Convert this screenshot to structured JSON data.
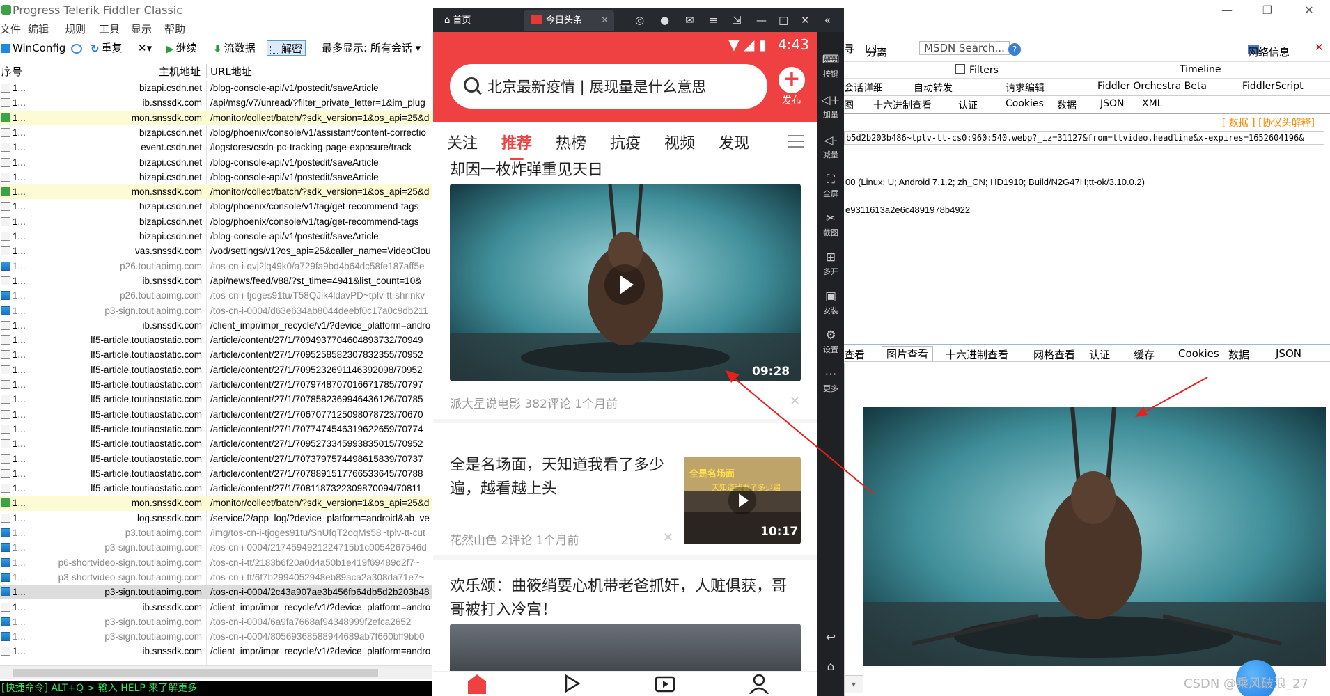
{
  "fiddler": {
    "title": "Progress Telerik Fiddler Classic",
    "window_controls": [
      "—",
      "❐",
      "✕"
    ],
    "menu": [
      "文件",
      "编辑",
      "规则",
      "工具",
      "显示",
      "帮助"
    ],
    "toolbar": {
      "winconfig": "WinConfig",
      "replay": "重复",
      "remove": "✕▾",
      "resume": "继续",
      "stream": "流数据",
      "decode": "解密",
      "keep": "最多显示: 所有会话 ▾"
    },
    "columns": {
      "num": "序号",
      "host": "主机地址",
      "url": "URL地址"
    },
    "sessions": [
      {
        "icon": "js",
        "num": "1...",
        "host": "bizapi.csdn.net",
        "url": "/blog-console-api/v1/postedit/saveArticle",
        "style": ""
      },
      {
        "icon": "js",
        "num": "1...",
        "host": "ib.snssdk.com",
        "url": "/api/msg/v7/unread/?filter_private_letter=1&im_plug",
        "style": ""
      },
      {
        "icon": "upd",
        "num": "1...",
        "host": "mon.snssdk.com",
        "url": "/monitor/collect/batch/?sdk_version=1&os_api=25&d",
        "style": "hl"
      },
      {
        "icon": "js",
        "num": "1...",
        "host": "bizapi.csdn.net",
        "url": "/blog/phoenix/console/v1/assistant/content-correctio",
        "style": ""
      },
      {
        "icon": "js",
        "num": "1...",
        "host": "event.csdn.net",
        "url": "/logstores/csdn-pc-tracking-page-exposure/track",
        "style": ""
      },
      {
        "icon": "js",
        "num": "1...",
        "host": "bizapi.csdn.net",
        "url": "/blog-console-api/v1/postedit/saveArticle",
        "style": ""
      },
      {
        "icon": "js",
        "num": "1...",
        "host": "bizapi.csdn.net",
        "url": "/blog-console-api/v1/postedit/saveArticle",
        "style": ""
      },
      {
        "icon": "upd",
        "num": "1...",
        "host": "mon.snssdk.com",
        "url": "/monitor/collect/batch/?sdk_version=1&os_api=25&d",
        "style": "hl"
      },
      {
        "icon": "js",
        "num": "1...",
        "host": "bizapi.csdn.net",
        "url": "/blog/phoenix/console/v1/tag/get-recommend-tags",
        "style": ""
      },
      {
        "icon": "js",
        "num": "1...",
        "host": "bizapi.csdn.net",
        "url": "/blog/phoenix/console/v1/tag/get-recommend-tags",
        "style": ""
      },
      {
        "icon": "js",
        "num": "1...",
        "host": "bizapi.csdn.net",
        "url": "/blog-console-api/v1/postedit/saveArticle",
        "style": ""
      },
      {
        "icon": "js",
        "num": "1...",
        "host": "vas.snssdk.com",
        "url": "/vod/settings/v1?os_api=25&caller_name=VideoClou",
        "style": ""
      },
      {
        "icon": "img",
        "num": "1...",
        "host": "p26.toutiaoimg.com",
        "url": "/tos-cn-i-qvj2lq49k0/a729fa9bd4b64dc58fe187aff5e",
        "style": "gray"
      },
      {
        "icon": "js",
        "num": "1...",
        "host": "ib.snssdk.com",
        "url": "/api/news/feed/v88/?st_time=4941&list_count=10&",
        "style": ""
      },
      {
        "icon": "img",
        "num": "1...",
        "host": "p26.toutiaoimg.com",
        "url": "/tos-cn-i-tjoges91tu/T58QJlk4ldavPD~tplv-tt-shrinkv",
        "style": "gray"
      },
      {
        "icon": "img",
        "num": "1...",
        "host": "p3-sign.toutiaoimg.com",
        "url": "/tos-cn-i-0004/d63e634ab8044deebf0c17a0c9db211",
        "style": "gray"
      },
      {
        "icon": "js",
        "num": "1...",
        "host": "ib.snssdk.com",
        "url": "/client_impr/impr_recycle/v1/?device_platform=andro",
        "style": ""
      },
      {
        "icon": "js",
        "num": "1...",
        "host": "lf5-article.toutiaostatic.com",
        "url": "/article/content/27/1/7094937704604893732/70949",
        "style": ""
      },
      {
        "icon": "js",
        "num": "1...",
        "host": "lf5-article.toutiaostatic.com",
        "url": "/article/content/27/1/7095258582307832355/70952",
        "style": ""
      },
      {
        "icon": "js",
        "num": "1...",
        "host": "lf5-article.toutiaostatic.com",
        "url": "/article/content/27/1/7095232691146392098/70952",
        "style": ""
      },
      {
        "icon": "js",
        "num": "1...",
        "host": "lf5-article.toutiaostatic.com",
        "url": "/article/content/27/1/7079748707016671785/70797",
        "style": ""
      },
      {
        "icon": "js",
        "num": "1...",
        "host": "lf5-article.toutiaostatic.com",
        "url": "/article/content/27/1/7078582369946436126/70785",
        "style": ""
      },
      {
        "icon": "js",
        "num": "1...",
        "host": "lf5-article.toutiaostatic.com",
        "url": "/article/content/27/1/7067077125098078723/70670",
        "style": ""
      },
      {
        "icon": "js",
        "num": "1...",
        "host": "lf5-article.toutiaostatic.com",
        "url": "/article/content/27/1/7077474546319622659/70774",
        "style": ""
      },
      {
        "icon": "js",
        "num": "1...",
        "host": "lf5-article.toutiaostatic.com",
        "url": "/article/content/27/1/7095273345993835015/70952",
        "style": ""
      },
      {
        "icon": "js",
        "num": "1...",
        "host": "lf5-article.toutiaostatic.com",
        "url": "/article/content/27/1/7073797574498615839/70737",
        "style": ""
      },
      {
        "icon": "js",
        "num": "1...",
        "host": "lf5-article.toutiaostatic.com",
        "url": "/article/content/27/1/7078891517766533645/70788",
        "style": ""
      },
      {
        "icon": "js",
        "num": "1...",
        "host": "lf5-article.toutiaostatic.com",
        "url": "/article/content/27/1/7081187322309870094/70811",
        "style": ""
      },
      {
        "icon": "upd",
        "num": "1...",
        "host": "mon.snssdk.com",
        "url": "/monitor/collect/batch/?sdk_version=1&os_api=25&d",
        "style": "hl"
      },
      {
        "icon": "js",
        "num": "1...",
        "host": "log.snssdk.com",
        "url": "/service/2/app_log/?device_platform=android&ab_ve",
        "style": ""
      },
      {
        "icon": "img",
        "num": "1...",
        "host": "p3.toutiaoimg.com",
        "url": "/img/tos-cn-i-tjoges91tu/SnUfqT2oqMs58~tplv-tt-cut",
        "style": "gray"
      },
      {
        "icon": "img",
        "num": "1...",
        "host": "p3-sign.toutiaoimg.com",
        "url": "/tos-cn-i-0004/2174594921224715b1c0054267546d",
        "style": "gray"
      },
      {
        "icon": "img",
        "num": "1...",
        "host": "p6-shortvideo-sign.toutiaoimg.com",
        "url": "/tos-cn-i-tt/2183b6f20a0d4a50b1e419f69489d2f7~",
        "style": "gray"
      },
      {
        "icon": "img",
        "num": "1...",
        "host": "p3-shortvideo-sign.toutiaoimg.com",
        "url": "/tos-cn-i-tt/6f7b2994052948eb89aca2a308da71e7~",
        "style": "gray"
      },
      {
        "icon": "img",
        "num": "1...",
        "host": "p3-sign.toutiaoimg.com",
        "url": "/tos-cn-i-0004/2c43a907ae3b456fb64db5d2b203b48",
        "style": "sel"
      },
      {
        "icon": "js",
        "num": "1...",
        "host": "ib.snssdk.com",
        "url": "/client_impr/impr_recycle/v1/?device_platform=andro",
        "style": ""
      },
      {
        "icon": "img",
        "num": "1...",
        "host": "p3-sign.toutiaoimg.com",
        "url": "/tos-cn-i-0004/6a9fa7668af94348999f2efca2652",
        "style": "gray"
      },
      {
        "icon": "img",
        "num": "1...",
        "host": "p3-sign.toutiaoimg.com",
        "url": "/tos-cn-i-0004/80569368588944689ab7f660bff9bb0",
        "style": "gray"
      },
      {
        "icon": "js",
        "num": "1...",
        "host": "ib.snssdk.com",
        "url": "/client_impr/impr_recycle/v1/?device_platform=andro",
        "style": ""
      }
    ],
    "quickexec": "[快捷命令] ALT+Q > 输入 HELP 来了解更多",
    "right_toolbar": {
      "a": "寻",
      "split": "分离",
      "msdn": "MSDN Search...",
      "help": "?",
      "netinfo": "网络信息",
      "close": "✕"
    },
    "right_tabs_row1": {
      "filters": "Filters",
      "timeline": "Timeline"
    },
    "right_tabs_row2": [
      "会话详细",
      "自动转发",
      "请求编辑",
      "Fiddler Orchestra Beta",
      "FiddlerScript"
    ],
    "right_tabs_row3": [
      "图",
      "十六进制查看",
      "认证",
      "Cookies",
      "数据",
      "JSON",
      "XML"
    ],
    "proto_bar": "[ 数据 ] [协议头解释]",
    "request_line": "b5d2b203b486~tplv-tt-cs0:960:540.webp?_iz=31127&from=ttvideo.headlinе&x-expires=1652604196&",
    "request_ua": "00 (Linux; U; Android 7.1.2; zh_CN; HD1910; Build/N2G47H;tt-ok/3.10.0.2)",
    "request_hash": "e9311613a2e6c4891978b4922",
    "response_tabs": [
      "查看",
      "图片查看",
      "十六进制查看",
      "网格查看",
      "认证",
      "缓存",
      "Cookies",
      "数据",
      "JSON"
    ],
    "watermark": "CSDN @乘风破浪_27"
  },
  "emulator": {
    "tab_home": "首页",
    "tab_current": "今日头条",
    "tab_close": "✕",
    "status_time": "4:43",
    "search_query": "北京最新疫情 | 展现量是什么意思",
    "publish": "发布",
    "channels": [
      "关注",
      "推荐",
      "热榜",
      "抗疫",
      "视频",
      "发现"
    ],
    "side": [
      "按键",
      "加量",
      "减量",
      "全屏",
      "截图",
      "多开",
      "安装",
      "设置",
      "更多"
    ],
    "feed": [
      {
        "title": "却因一枚炸弹重见天日",
        "duration": "09:28",
        "meta": "派大星说电影  382评论  1个月前"
      },
      {
        "title": "全是名场面，天知道我看了多少遍，越看越上头",
        "duration": "10:17",
        "thumb_caption1": "全是名场面",
        "thumb_caption2": "天知道我看了多少遍",
        "meta": "花然山色  2评论  1个月前"
      },
      {
        "title": "欢乐颂：曲筱绡耍心机带老爸抓奸，人赃俱获，哥哥被打入冷宫！"
      }
    ]
  }
}
